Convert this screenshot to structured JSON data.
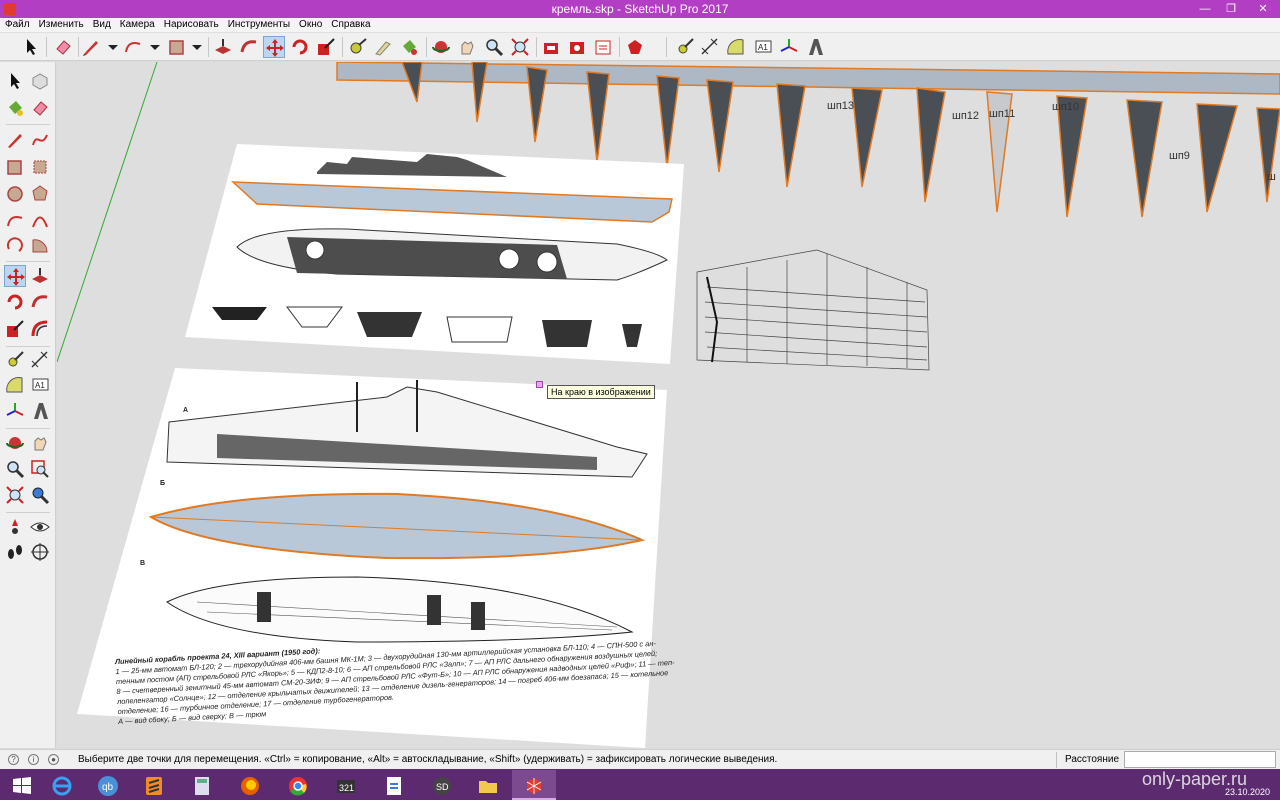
{
  "window": {
    "title": "кремль.skp - SketchUp Pro 2017",
    "minimize": "—",
    "restore": "❐",
    "close": "✕"
  },
  "menu": [
    "Файл",
    "Изменить",
    "Вид",
    "Камера",
    "Нарисовать",
    "Инструменты",
    "Окно",
    "Справка"
  ],
  "toolbar": {
    "tools": [
      "select-icon",
      "eraser-icon",
      "pencil-icon",
      "arc-icon",
      "rectangle-icon",
      "push-pull-icon",
      "follow-me-icon",
      "move-icon",
      "rotate-icon",
      "scale-icon",
      "tape-measure-icon",
      "paint-bucket-icon",
      "orbit-icon",
      "pan-icon",
      "zoom-icon",
      "zoom-extents-icon",
      "warehouse-icon",
      "extension-warehouse-icon",
      "layout-icon",
      "extension-manager-icon",
      "tape-icon",
      "dimension-icon",
      "protractor-icon",
      "text-icon",
      "axes-icon",
      "3d-text-icon"
    ],
    "active_tool": "move-icon"
  },
  "viewport": {
    "tooltip": "На краю в изображении",
    "frame_labels": [
      "шп13",
      "шп12",
      "шп11",
      "шп10",
      "шп9",
      "ш"
    ],
    "drawing_caption": {
      "title": "Линейный корабль проекта 24, XIII вариант (1950 год):",
      "line1": "1 — 25-мм автомат БЛ-120; 2 — трехорудийная 406-мм башня МК-1М; 3 — двухорудийная 130-мм артиллерийская установка БЛ-110; 4 — СПН-500 с ан-",
      "line2": "тенным постом (АП) стрельбовой РЛС «Якорь»; 5 — КДП2-8-10; 6 — АП стрельбовой РЛС «Залп»; 7 — АП РЛС дальнего обнаружения воздушных целей;",
      "line3": "8 — счетверенный зенитный 45-мм автомат СМ-20-ЗИФ; 9 — АП стрельбовой РЛС «Фут-Б»; 10 — АП РЛС обнаружения надводных целей «Риф»; 11 — теп-",
      "line4": "лопеленгатор «Солнце»; 12 — отделение крыльчатых движителей; 13 — отделение дизель-генераторов; 14 — погреб 406-мм боезапаса; 15 — котельное",
      "line5": "отделение; 16 — турбинное отделение; 17 — отделение турбогенераторов.",
      "line6": "А — вид сбоку; Б — вид сверху; В — трюм"
    },
    "view_letters": [
      "А",
      "Б",
      "В"
    ]
  },
  "statusbar": {
    "message": "Выберите две точки для перемещения.  «Ctrl» = копирование, «Alt» = автоскладывание, «Shift» (удерживать) = зафиксировать логические выведения.",
    "distance_label": "Расстояние",
    "distance_value": ""
  },
  "taskbar": {
    "apps": [
      "windows-start-icon",
      "internet-explorer-icon",
      "qbittorrent-icon",
      "sublime-icon",
      "calculator-icon",
      "firefox-icon",
      "chrome-icon",
      "video-editor-icon",
      "pdf-editor-icon",
      "sketchup-sd-icon",
      "file-explorer-icon",
      "sketchup-icon"
    ],
    "watermark": "only-paper.ru",
    "date": "23.10.2020"
  },
  "colors": {
    "titlebar": "#b23fc3",
    "taskbar": "#5c2a6f",
    "selection": "#e07a24",
    "face": "#b8c8d8",
    "viewport": "#dedede"
  }
}
